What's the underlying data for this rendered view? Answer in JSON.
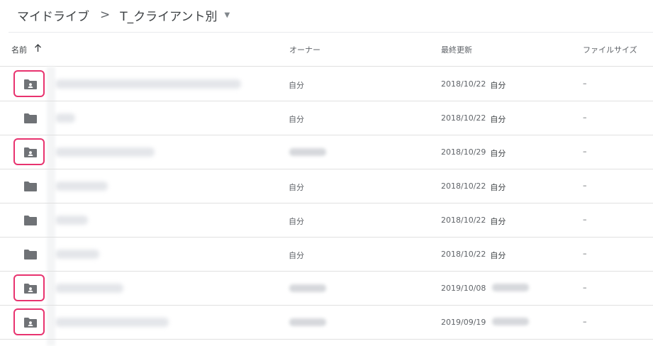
{
  "breadcrumb": {
    "root": "マイドライブ",
    "separator": ">",
    "current": "T_クライアント別",
    "caret_icon": "caret-down-icon"
  },
  "columns": {
    "name": "名前",
    "sort_icon": "arrow-up-icon",
    "owner": "オーナー",
    "modified": "最終更新",
    "size": "ファイルサイズ"
  },
  "colors": {
    "highlight": "#e8336f",
    "folder_icon": "#6f7276"
  },
  "rows": [
    {
      "icon": "shared-folder-icon",
      "highlighted": true,
      "owner": "自分",
      "date": "2018/10/22",
      "modified_by": "自分",
      "size": "–"
    },
    {
      "icon": "folder-icon",
      "highlighted": false,
      "owner": "自分",
      "date": "2018/10/22",
      "modified_by": "自分",
      "size": "–"
    },
    {
      "icon": "shared-folder-icon",
      "highlighted": true,
      "owner": "",
      "date": "2018/10/29",
      "modified_by": "自分",
      "size": "–"
    },
    {
      "icon": "folder-icon",
      "highlighted": false,
      "owner": "自分",
      "date": "2018/10/22",
      "modified_by": "自分",
      "size": "–"
    },
    {
      "icon": "folder-icon",
      "highlighted": false,
      "owner": "自分",
      "date": "2018/10/22",
      "modified_by": "自分",
      "size": "–"
    },
    {
      "icon": "folder-icon",
      "highlighted": false,
      "owner": "自分",
      "date": "2018/10/22",
      "modified_by": "自分",
      "size": "–"
    },
    {
      "icon": "shared-folder-icon",
      "highlighted": true,
      "owner": "",
      "date": "2019/10/08",
      "modified_by": "",
      "size": "–"
    },
    {
      "icon": "shared-folder-icon",
      "highlighted": true,
      "owner": "",
      "date": "2019/09/19",
      "modified_by": "",
      "size": "–"
    }
  ]
}
